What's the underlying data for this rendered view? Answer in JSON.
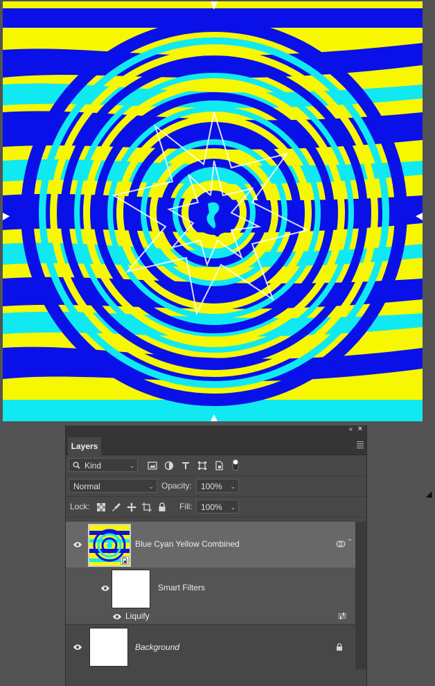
{
  "panel": {
    "title": "Layers",
    "collapse_icon": "«",
    "close_icon": "×",
    "filter": {
      "kind_label": "Kind"
    },
    "blend_mode": "Normal",
    "opacity_label": "Opacity:",
    "opacity_value": "100%",
    "lock_label": "Lock:",
    "fill_label": "Fill:",
    "fill_value": "100%"
  },
  "layers": [
    {
      "name": "Blue Cyan Yellow Combined",
      "visible": true,
      "selected": true,
      "type": "smart-object"
    },
    {
      "name": "Smart Filters",
      "visible": true
    },
    {
      "name": "Liquify",
      "visible": true
    },
    {
      "name": "Background",
      "visible": true,
      "locked": true
    }
  ],
  "colors": {
    "blue": "#0a10e8",
    "cyan": "#11e9f2",
    "yellow": "#f6f700",
    "white": "#ffffff",
    "panel_bg": "#474747",
    "selected_layer": "#686868"
  }
}
